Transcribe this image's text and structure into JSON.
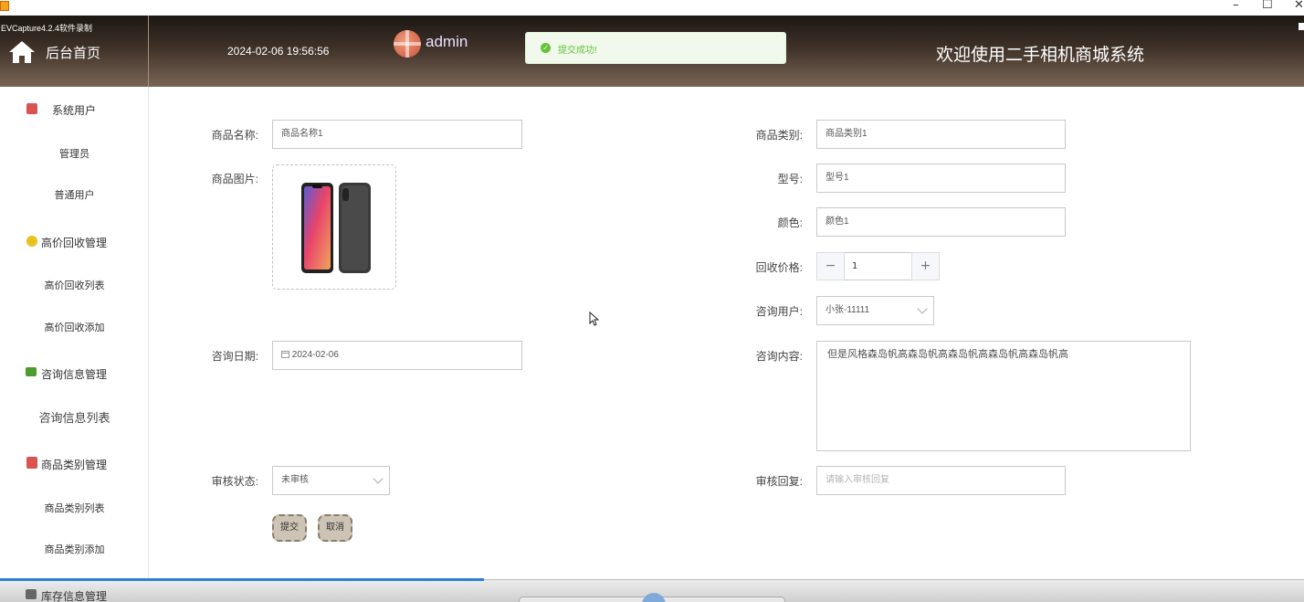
{
  "window": {
    "recorder_title": "EVCapture4.2.4软件录制",
    "controls": [
      "–",
      "☐",
      "✕"
    ]
  },
  "header": {
    "home_label": "后台首页",
    "datetime": "2024-02-06 19:56:56",
    "username": "admin",
    "welcome": "欢迎使用二手相机商城系统"
  },
  "toast": {
    "message": "提交成功!"
  },
  "sidebar": {
    "groups": [
      {
        "label": "系统用户",
        "icon": "user-icon",
        "color": "#d9534f"
      },
      {
        "label": "高价回收管理",
        "icon": "box-icon",
        "color": "#e8c21c"
      },
      {
        "label": "咨询信息管理",
        "icon": "chat-icon",
        "color": "#4b9b2e"
      },
      {
        "label": "商品类别管理",
        "icon": "book-icon",
        "color": "#d9534f"
      },
      {
        "label": "库存信息管理",
        "icon": "stack-icon",
        "color": "#555555"
      }
    ],
    "items": {
      "admin": "管理员",
      "normal_user": "普通用户",
      "recycle_list": "高价回收列表",
      "recycle_add": "高价回收添加",
      "consult_list": "咨询信息列表",
      "category_list": "商品类别列表",
      "category_add": "商品类别添加"
    }
  },
  "form": {
    "product_name": {
      "label": "商品名称:",
      "value": "商品名称1"
    },
    "product_image": {
      "label": "商品图片:"
    },
    "product_category": {
      "label": "商品类别:",
      "value": "商品类别1"
    },
    "model": {
      "label": "型号:",
      "value": "型号1"
    },
    "color": {
      "label": "颜色:",
      "value": "颜色1"
    },
    "recycle_price": {
      "label": "回收价格:",
      "value": "1",
      "minus": "−",
      "plus": "+"
    },
    "consult_user": {
      "label": "咨询用户:",
      "value": "小张-11111"
    },
    "consult_date": {
      "label": "咨询日期:",
      "value": "2024-02-06"
    },
    "consult_content": {
      "label": "咨询内容:",
      "value": "但是风格森岛帆高森岛帆高森岛帆高森岛帆高森岛帆高"
    },
    "review_status": {
      "label": "审核状态:",
      "value": "未审核"
    },
    "review_reply": {
      "label": "审核回复:",
      "placeholder": "请输入审核回复"
    },
    "submit": "提交",
    "cancel": "取消"
  }
}
